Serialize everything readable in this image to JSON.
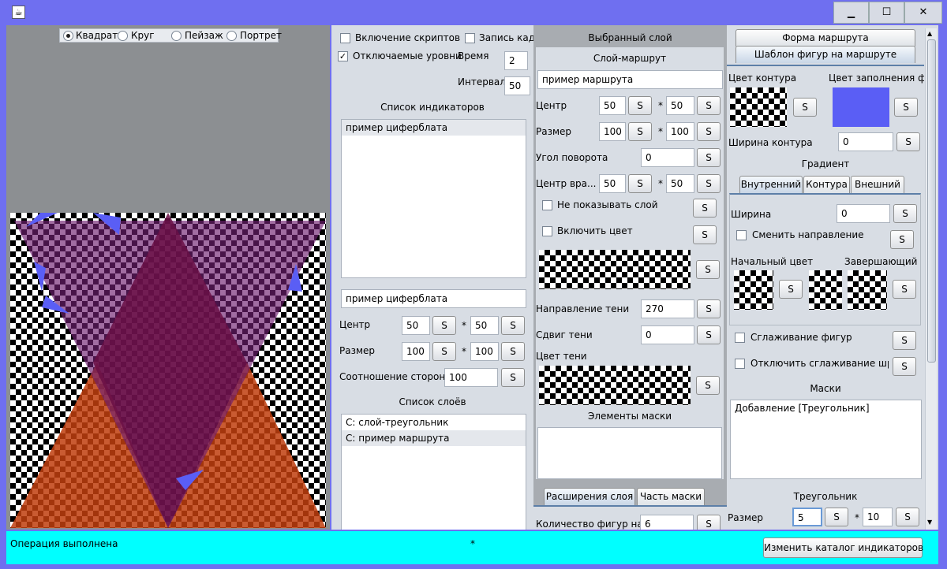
{
  "window": {
    "minimize_glyph": "▁",
    "maximize_glyph": "☐",
    "close_glyph": "✕"
  },
  "orientation": {
    "options": [
      "Квадрат",
      "Круг",
      "Пейзаж",
      "Портрет"
    ],
    "selected": "Квадрат"
  },
  "left_panel": {
    "scripts_label": "Включение скриптов",
    "record_label": "Запись кадр",
    "levels_label": "Отключаемые уровни",
    "time_label": "Время",
    "time_value": "2",
    "interval_label": "Интервал",
    "interval_value": "50",
    "indicators_title": "Список индикаторов",
    "indicators": [
      "пример циферблата"
    ],
    "indicator_name": "пример циферблата",
    "center_label": "Центр",
    "center_x": "50",
    "center_y": "50",
    "size_label": "Размер",
    "size_w": "100",
    "size_h": "100",
    "aspect_label": "Соотношение сторон",
    "aspect_value": "100",
    "layers_title": "Список слоёв",
    "layers": [
      "С: слой-треугольник",
      "С: пример маршрута"
    ]
  },
  "mid_panel": {
    "title": "Выбранный слой",
    "subtitle": "Слой-маршрут",
    "layer_name": "пример маршрута",
    "center_label": "Центр",
    "center_x": "50",
    "center_y": "50",
    "size_label": "Размер",
    "size_w": "100",
    "size_h": "100",
    "angle_label": "Угол поворота",
    "angle_value": "0",
    "rot_center_label": "Центр вра...",
    "rot_x": "50",
    "rot_y": "50",
    "hide_layer_label": "Не показывать слой",
    "enable_color_label": "Включить цвет",
    "shadow_dir_label": "Направление тени",
    "shadow_dir_value": "270",
    "shadow_shift_label": "Сдвиг тени",
    "shadow_shift_value": "0",
    "shadow_color_label": "Цвет тени",
    "mask_elements_title": "Элементы маски",
    "tabs": [
      "Расширения слоя",
      "Часть маски"
    ],
    "shapes_count_label": "Количество фигур на ма",
    "shapes_count_value": "6"
  },
  "right_panel": {
    "tabs": [
      "Форма маршрута",
      "Шаблон фигур на маршруте"
    ],
    "outline_color_label": "Цвет контура",
    "fill_color_label": "Цвет заполнения фи",
    "fill_color": "#5a5ef5",
    "outline_width_label": "Ширина контура",
    "outline_width_value": "0",
    "gradient_title": "Градиент",
    "gradient_tabs": [
      "Внутренний",
      "Контура",
      "Внешний"
    ],
    "gradient_width_label": "Ширина",
    "gradient_width_value": "0",
    "change_direction_label": "Сменить направление",
    "start_color_label": "Начальный цвет",
    "end_color_label": "Завершающий ...",
    "smooth_label": "Сглаживание фигур",
    "disable_smooth_label": "Отключить сглаживание шри...",
    "masks_title": "Маски",
    "masks": [
      "Добавление [Треугольник]"
    ],
    "triangle_title": "Треугольник",
    "size_label": "Размер",
    "size_a": "5",
    "size_b": "10"
  },
  "common": {
    "s_label": "S",
    "times": "*"
  },
  "status": {
    "message": "Операция выполнена",
    "center": "*",
    "catalog_button": "Изменить каталог индикаторов"
  }
}
